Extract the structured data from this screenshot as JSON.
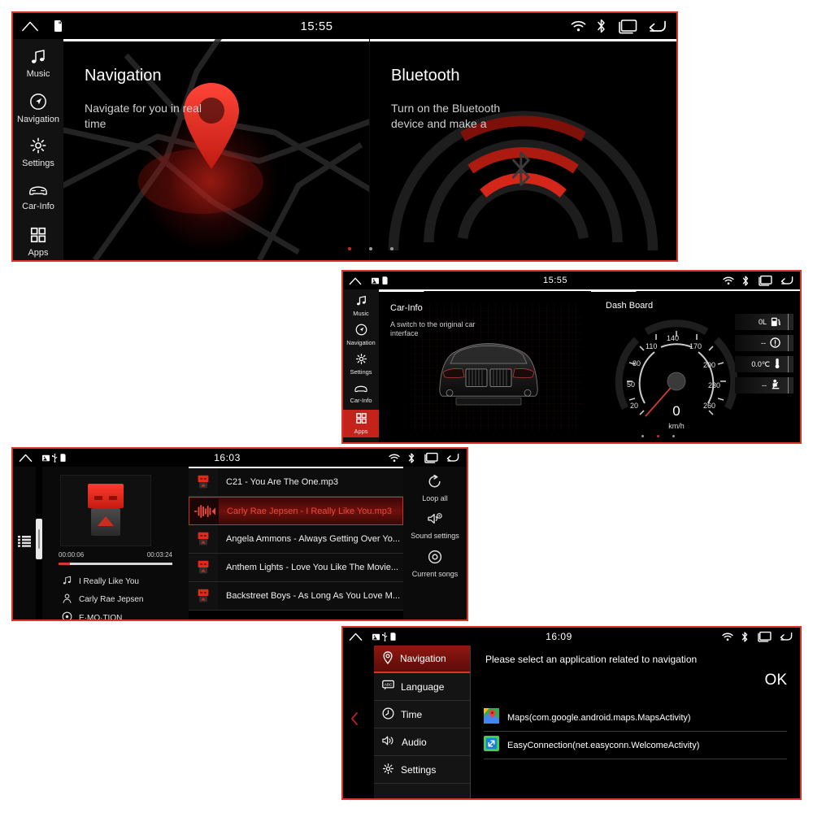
{
  "panels": {
    "home": {
      "status": {
        "time": "15:55",
        "icons": [
          "home-icon",
          "sd-card-icon"
        ],
        "right_icons": [
          "wifi-icon",
          "bluetooth-icon",
          "recents-icon",
          "back-icon"
        ]
      },
      "rail": [
        {
          "label": "Music",
          "icon": "music-note-icon",
          "active": false
        },
        {
          "label": "Navigation",
          "icon": "navigation-compass-icon",
          "active": false
        },
        {
          "label": "Settings",
          "icon": "gear-icon",
          "active": false
        },
        {
          "label": "Car-Info",
          "icon": "car-icon",
          "active": false
        },
        {
          "label": "Apps",
          "icon": "grid-apps-icon",
          "active": false
        }
      ],
      "cards": [
        {
          "title": "Navigation",
          "subtitle": "Navigate for you in real time",
          "art": "map-pin"
        },
        {
          "title": "Bluetooth",
          "subtitle": "Turn on the Bluetooth device and make a",
          "art": "bluetooth-waves"
        }
      ],
      "pager": {
        "count": 3,
        "active_index": 0
      }
    },
    "carinfo": {
      "status": {
        "time": "15:55",
        "icons": [
          "home-icon",
          "sd-card-icon",
          "lock-icon"
        ],
        "right_icons": [
          "wifi-icon",
          "bluetooth-icon",
          "recents-icon",
          "back-icon"
        ]
      },
      "rail": [
        {
          "label": "Music",
          "icon": "music-note-icon",
          "active": false
        },
        {
          "label": "Navigation",
          "icon": "navigation-compass-icon",
          "active": false
        },
        {
          "label": "Settings",
          "icon": "gear-icon",
          "active": false
        },
        {
          "label": "Car-Info",
          "icon": "car-icon",
          "active": false
        },
        {
          "label": "Apps",
          "icon": "grid-apps-icon",
          "active": true
        }
      ],
      "card": {
        "title": "Car-Info",
        "subtitle": "A switch to the original car interface"
      },
      "dash": {
        "title": "Dash Board",
        "speed_value": "0",
        "speed_unit": "km/h",
        "ticks": [
          "20",
          "50",
          "80",
          "110",
          "140",
          "170",
          "200",
          "230",
          "260"
        ],
        "indicators": [
          {
            "value": "0L",
            "icon": "fuel-pump-icon"
          },
          {
            "value": "--",
            "icon": "tire-pressure-icon"
          },
          {
            "value": "0.0℃",
            "icon": "thermometer-icon"
          },
          {
            "value": "--",
            "icon": "seatbelt-icon"
          }
        ]
      },
      "pager": {
        "count": 3,
        "active_index": 1
      }
    },
    "music": {
      "status": {
        "time": "16:03",
        "icons": [
          "home-icon",
          "sd-card-icon",
          "usb-icon",
          "lock-icon"
        ],
        "right_icons": [
          "wifi-icon",
          "bluetooth-icon",
          "recents-icon",
          "back-icon"
        ]
      },
      "list_toggle_icon": "list-icon",
      "progress": {
        "elapsed": "00:00:06",
        "total": "00:03:24",
        "percent": 3
      },
      "now_playing": {
        "title": "I Really Like You",
        "artist": "Carly Rae Jepsen",
        "album": "E·MO·TION"
      },
      "tracks": [
        {
          "name": "C21 - You Are The One.mp3",
          "active": false
        },
        {
          "name": "Carly Rae Jepsen - I Really Like You.mp3",
          "active": true
        },
        {
          "name": "Angela Ammons - Always Getting Over Yo...",
          "active": false
        },
        {
          "name": "Anthem Lights - Love You Like The Movie...",
          "active": false
        },
        {
          "name": "Backstreet Boys - As Long As You Love M...",
          "active": false
        }
      ],
      "options": [
        {
          "label": "Loop all",
          "icon": "loop-icon"
        },
        {
          "label": "Sound settings",
          "icon": "sound-settings-icon"
        },
        {
          "label": "Current songs",
          "icon": "current-songs-icon"
        }
      ]
    },
    "settings": {
      "status": {
        "time": "16:09",
        "icons": [
          "home-icon",
          "sd-card-icon",
          "usb-icon",
          "lock-icon"
        ],
        "right_icons": [
          "wifi-icon",
          "bluetooth-icon",
          "recents-icon",
          "back-icon"
        ]
      },
      "collapse_icon": "chevron-left-icon",
      "menu": [
        {
          "label": "Navigation",
          "icon": "location-pin-icon",
          "active": true
        },
        {
          "label": "Language",
          "icon": "abc-keyboard-icon",
          "active": false
        },
        {
          "label": "Time",
          "icon": "clock-icon",
          "active": false
        },
        {
          "label": "Audio",
          "icon": "speaker-icon",
          "active": false
        },
        {
          "label": "Settings",
          "icon": "gear-icon",
          "active": false
        }
      ],
      "hint": "Please select an application related to navigation",
      "ok_label": "OK",
      "apps": [
        {
          "label": "Maps(com.google.android.maps.MapsActivity)",
          "icon": "google-maps-icon"
        },
        {
          "label": "EasyConnection(net.easyconn.WelcomeActivity)",
          "icon": "easyconnection-icon"
        }
      ]
    }
  },
  "colors": {
    "accent_red": "#d9352b",
    "panel_bg": "#000000",
    "rail_bg": "#121212",
    "active_red": "#c4231b",
    "text_primary": "#ffffff",
    "text_secondary": "#cfcfcf"
  }
}
